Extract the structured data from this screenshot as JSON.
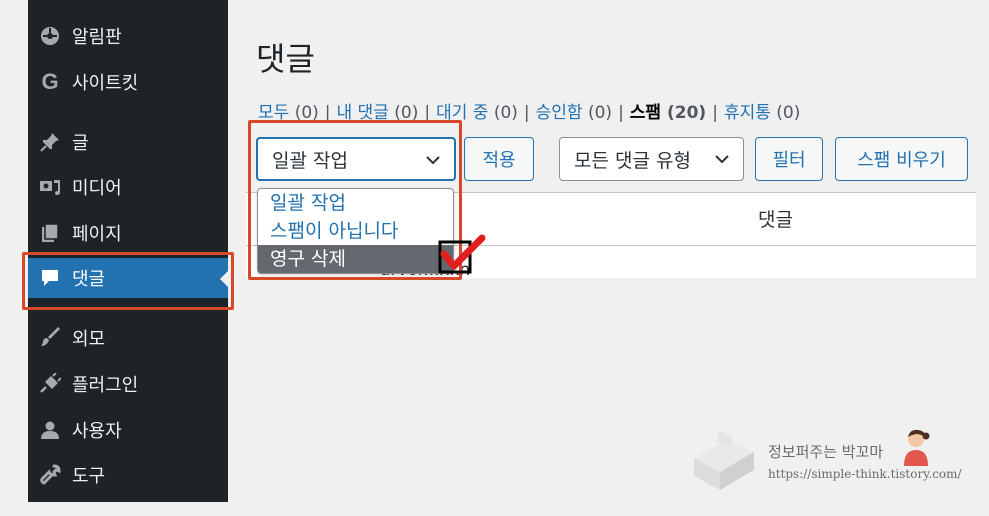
{
  "sidebar": {
    "items": [
      {
        "label": "알림판",
        "icon": "dashboard-icon"
      },
      {
        "label": "사이트킷",
        "icon": "g-icon"
      },
      {
        "label": "글",
        "icon": "pin-icon"
      },
      {
        "label": "미디어",
        "icon": "media-icon"
      },
      {
        "label": "페이지",
        "icon": "page-icon"
      },
      {
        "label": "댓글",
        "icon": "comment-icon",
        "active": true
      },
      {
        "label": "외모",
        "icon": "brush-icon"
      },
      {
        "label": "플러그인",
        "icon": "plugin-icon"
      },
      {
        "label": "사용자",
        "icon": "user-icon"
      },
      {
        "label": "도구",
        "icon": "wrench-icon"
      }
    ]
  },
  "main": {
    "title": "댓글",
    "filters": [
      {
        "label": "모두",
        "count": "(0)"
      },
      {
        "label": "내 댓글",
        "count": "(0)"
      },
      {
        "label": "대기 중",
        "count": "(0)"
      },
      {
        "label": "승인함",
        "count": "(0)"
      },
      {
        "label": "스팸",
        "count": "(20)",
        "current": true
      },
      {
        "label": "휴지통",
        "count": "(0)"
      }
    ],
    "bulk_action": {
      "selected": "일괄 작업"
    },
    "apply_label": "적용",
    "comment_type": {
      "selected": "모든 댓글 유형"
    },
    "filter_label": "필터",
    "empty_spam_label": "스팸 비우기",
    "table": {
      "col_comment": "댓글",
      "row_author": "arvor...xkn"
    },
    "dropdown_options": [
      "일괄 작업",
      "스팸이 아닙니다",
      "영구 삭제"
    ]
  },
  "watermark": {
    "title": "정보퍼주는 박꼬마",
    "url": "https://simple-think.tistory.com/"
  },
  "colors": {
    "highlight": "#d9472b",
    "accent": "#2271b1",
    "sidebar_bg": "#1d2327",
    "check": "#e02020"
  }
}
